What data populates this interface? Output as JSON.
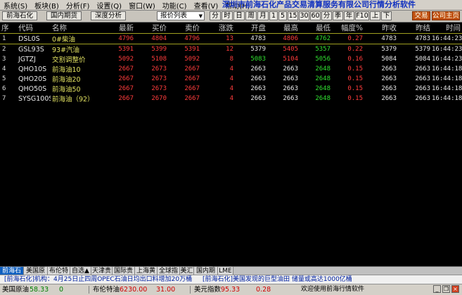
{
  "menu": {
    "items": [
      "系统(S)",
      "板块(B)",
      "分析(F)",
      "设置(Q)",
      "窗口(W)",
      "功能(C)",
      "查看(V)",
      "帮助(H)"
    ],
    "title": "深圳市前海石化产品交易清算服务有限公司行情分析软件"
  },
  "toolbar": {
    "btn_qianhai": "前海石化",
    "btn_domestic": "国内期货",
    "btn_depth": "深度分析",
    "dropdown": "报价列表",
    "keys": [
      "分",
      "时",
      "日",
      "周",
      "月",
      "1",
      "5",
      "15",
      "30",
      "60",
      "分",
      "季",
      "年",
      "F10",
      "上",
      "下"
    ],
    "btn_trade": "交易",
    "btn_company": "公司主页"
  },
  "table": {
    "headers": [
      "序",
      "代码",
      "名称",
      "最新",
      "买价",
      "卖价",
      "涨跌",
      "开盘",
      "最高",
      "最低",
      "幅度%",
      "昨收",
      "昨结",
      "时间"
    ],
    "rows": [
      {
        "idx": "1",
        "code": "DSL0S",
        "name": "0#柴油",
        "last": "4796",
        "bid": "4804",
        "ask": "4796",
        "chg": "13",
        "open": "4783",
        "high": "4806",
        "low": "4762",
        "pct": "0.27",
        "prev_close": "4783",
        "prev_settle": "4783",
        "time": "16:44:23"
      },
      {
        "idx": "2",
        "code": "GSL93S",
        "name": "93#汽油",
        "last": "5391",
        "bid": "5399",
        "ask": "5391",
        "chg": "12",
        "open": "5379",
        "high": "5405",
        "low": "5357",
        "pct": "0.22",
        "prev_close": "5379",
        "prev_settle": "5379",
        "time": "16:44:23"
      },
      {
        "idx": "3",
        "code": "JGTZJ",
        "name": "交割调整价",
        "last": "5092",
        "bid": "5108",
        "ask": "5092",
        "chg": "8",
        "open": "5083",
        "high": "5104",
        "low": "5056",
        "pct": "0.16",
        "prev_close": "5084",
        "prev_settle": "5084",
        "time": "16:44:23"
      },
      {
        "idx": "4",
        "code": "QHO10S",
        "name": "前海油10",
        "last": "2667",
        "bid": "2673",
        "ask": "2667",
        "chg": "4",
        "open": "2663",
        "high": "2663",
        "low": "2648",
        "pct": "0.15",
        "prev_close": "2663",
        "prev_settle": "2663",
        "time": "16:44:18"
      },
      {
        "idx": "5",
        "code": "QHO20S",
        "name": "前海油20",
        "last": "2667",
        "bid": "2673",
        "ask": "2667",
        "chg": "4",
        "open": "2663",
        "high": "2663",
        "low": "2648",
        "pct": "0.15",
        "prev_close": "2663",
        "prev_settle": "2663",
        "time": "16:44:18"
      },
      {
        "idx": "6",
        "code": "QHO50S",
        "name": "前海油50",
        "last": "2667",
        "bid": "2673",
        "ask": "2667",
        "chg": "4",
        "open": "2663",
        "high": "2663",
        "low": "2648",
        "pct": "0.15",
        "prev_close": "2663",
        "prev_settle": "2663",
        "time": "16:44:18"
      },
      {
        "idx": "7",
        "code": "SYSG100S",
        "name": "前海油（92）",
        "last": "2667",
        "bid": "2670",
        "ask": "2667",
        "chg": "4",
        "open": "2663",
        "high": "2663",
        "low": "2648",
        "pct": "0.15",
        "prev_close": "2663",
        "prev_settle": "2663",
        "time": "16:44:18"
      }
    ]
  },
  "tabs": [
    "前海石",
    "美国原",
    "布伦特",
    "自选▲",
    "天津贵",
    "国际贵",
    "上海黄",
    "全球指",
    "美汇",
    "国内期",
    "LME"
  ],
  "news": {
    "item1": "[前海石化]机构：4月25日止四周OPEC石油日均出口料增加20万桶",
    "item2": "[前海石化]美国发现的巨型油田 储量或高达1000亿桶",
    "welcome": "欢迎使用前海行情软件"
  },
  "status": {
    "us_crude_label": "美国原油",
    "us_crude_value": "58.33",
    "us_crude_chg": "0",
    "brent_label": "布伦特油",
    "brent_value": "6230.00",
    "brent_chg": "31.00",
    "usd_index_label": "美元指数",
    "usd_index_value": "95.33",
    "usd_index_chg": "0.28"
  },
  "colors": {
    "up": "#ff3c3c",
    "down": "#30e030",
    "background": "#000000"
  }
}
